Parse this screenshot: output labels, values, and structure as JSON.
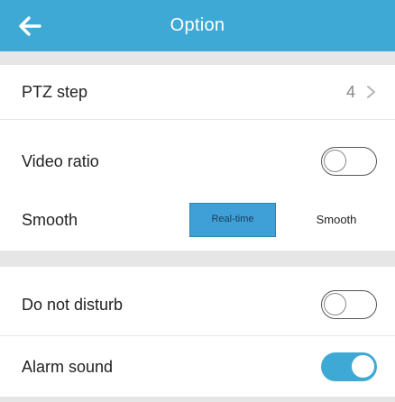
{
  "header": {
    "title": "Option",
    "back_icon": "arrow-left-icon"
  },
  "settings": {
    "ptz_step": {
      "label": "PTZ step",
      "value": "4"
    },
    "video_ratio": {
      "label": "Video ratio",
      "enabled": false
    },
    "smooth": {
      "label": "Smooth",
      "options": [
        "Real-time",
        "Smooth"
      ],
      "selected": "Real-time"
    },
    "do_not_disturb": {
      "label": "Do not disturb",
      "enabled": false
    },
    "alarm_sound": {
      "label": "Alarm sound",
      "enabled": true
    }
  },
  "colors": {
    "accent": "#3fa9d6",
    "separator": "#e6e6e6"
  }
}
